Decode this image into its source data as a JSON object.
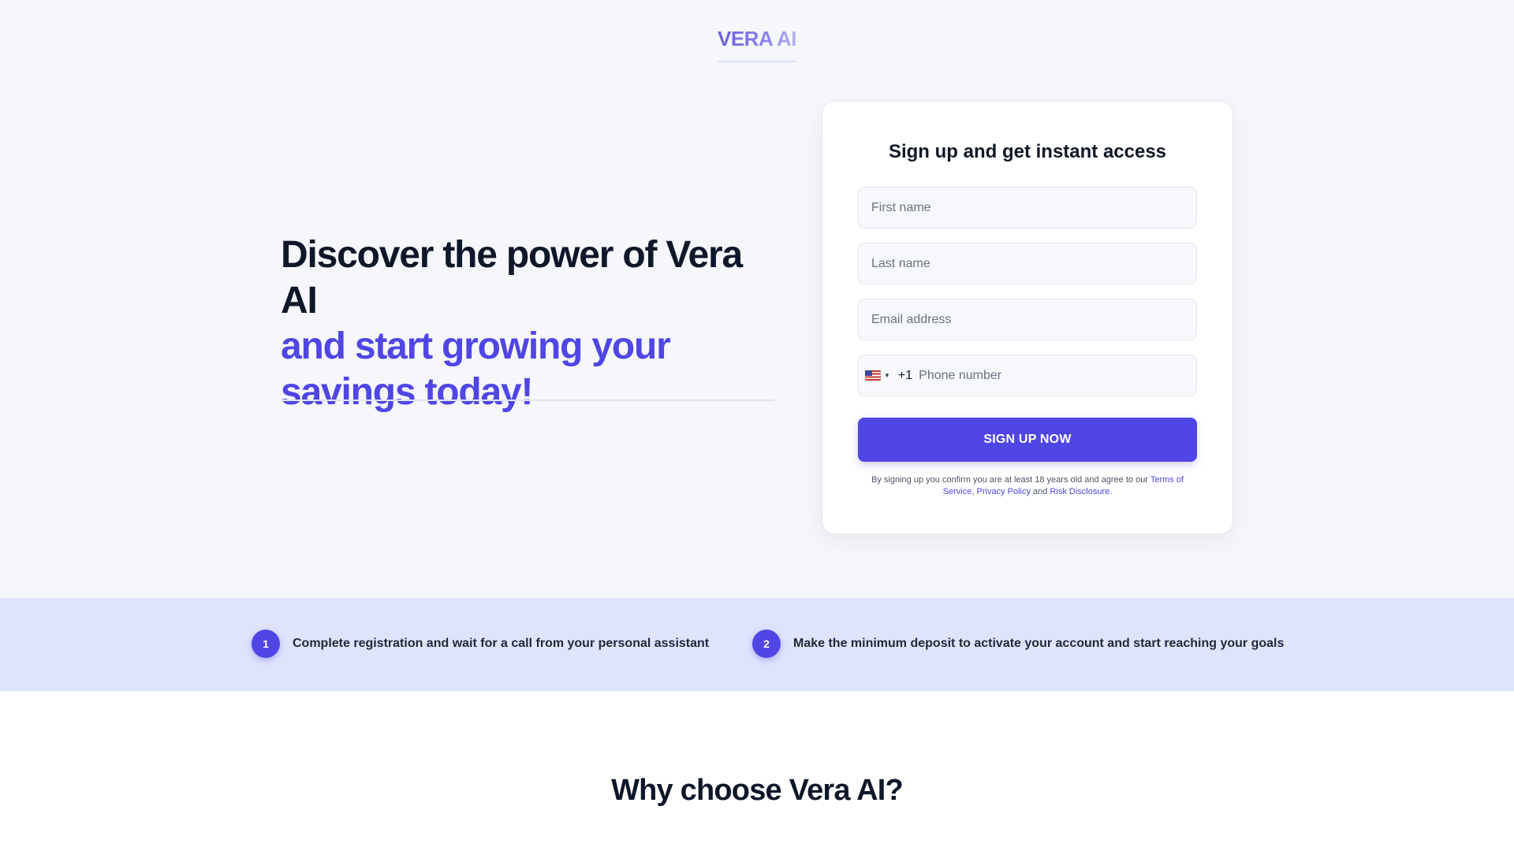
{
  "header": {
    "logo_text": "VERA AI"
  },
  "hero": {
    "line1": "Discover the power of Vera AI",
    "line2": "and start growing your savings today!"
  },
  "signup_form": {
    "title": "Sign up and get instant access",
    "first_name_placeholder": "First name",
    "last_name_placeholder": "Last name",
    "email_placeholder": "Email address",
    "phone": {
      "country_flag": "us-flag-icon",
      "dial_code": "+1",
      "placeholder": "Phone number"
    },
    "submit_label": "SIGN UP NOW",
    "disclaimer": {
      "prefix": "By signing up you confirm you are at least 18 years old and agree to our ",
      "terms_link": "Terms of Service",
      "sep1": ", ",
      "privacy_link": "Privacy Policy",
      "sep2": " and ",
      "risk_link": "Risk Disclosure",
      "suffix": "."
    }
  },
  "steps": [
    {
      "number": "1",
      "text": "Complete registration and wait for a call from your personal assistant"
    },
    {
      "number": "2",
      "text": "Make the minimum deposit to activate your account and start reaching your goals"
    }
  ],
  "why_section": {
    "title": "Why choose Vera AI?"
  },
  "colors": {
    "accent": "#4f46e5",
    "steps_band": "#e0e3fc",
    "page_bg": "#f6f7fb",
    "heading": "#0f172a"
  }
}
